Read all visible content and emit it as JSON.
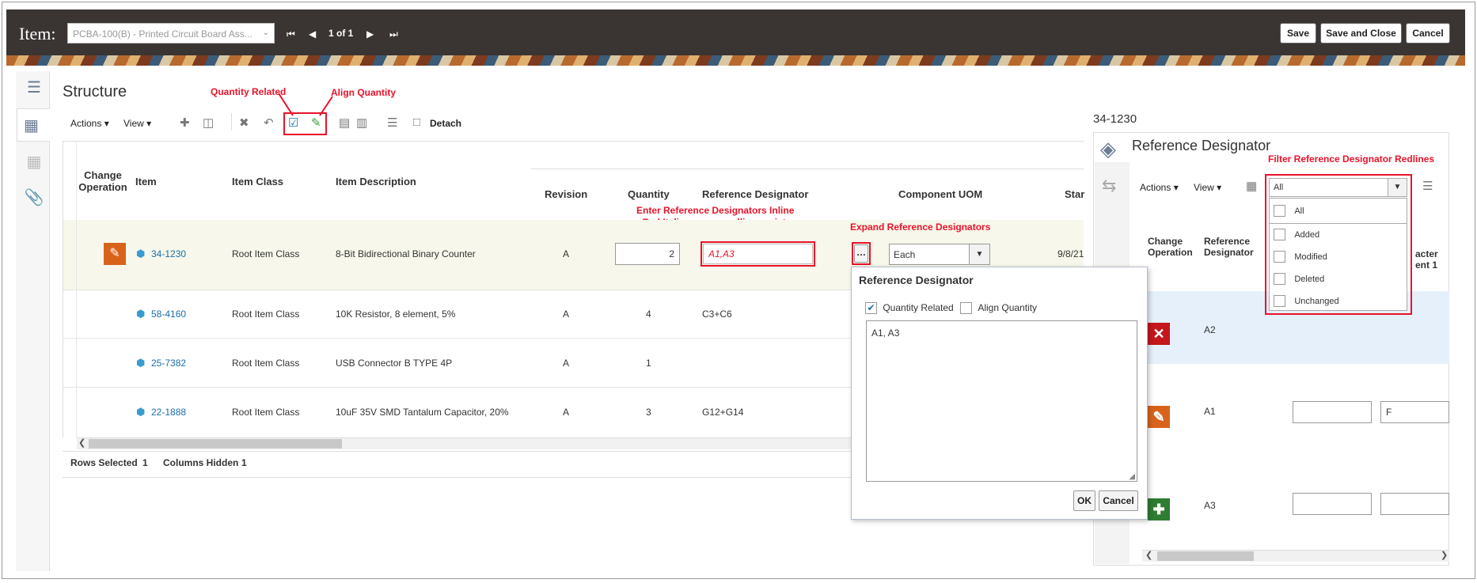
{
  "header": {
    "item_label": "Item:",
    "item_value": "PCBA-100(B) - Printed Circuit Board Ass...",
    "pager_text": "1 of 1",
    "save": "Save",
    "save_close": "Save and Close",
    "cancel": "Cancel"
  },
  "structure": {
    "title": "Structure",
    "actions": "Actions",
    "view": "View",
    "detach": "Detach",
    "columns": {
      "change_operation_1": "Change",
      "change_operation_2": "Operation",
      "item": "Item",
      "item_class": "Item Class",
      "item_description": "Item Description",
      "revision": "Revision",
      "quantity": "Quantity",
      "reference_designator": "Reference Designator",
      "component_uom": "Component UOM",
      "start": "Star"
    },
    "rows": [
      {
        "item": "34-1230",
        "class": "Root Item Class",
        "desc": "8-Bit Bidirectional Binary Counter",
        "rev": "A",
        "qty": "2",
        "refdes": "A1,A3",
        "uom": "Each",
        "start": "9/8/21"
      },
      {
        "item": "58-4160",
        "class": "Root Item Class",
        "desc": "10K Resistor, 8 element, 5%",
        "rev": "A",
        "qty": "4",
        "refdes": "C3+C6"
      },
      {
        "item": "25-7382",
        "class": "Root Item Class",
        "desc": "USB Connector B TYPE 4P",
        "rev": "A",
        "qty": "1",
        "refdes": ""
      },
      {
        "item": "22-1888",
        "class": "Root Item Class",
        "desc": "10uF 35V SMD Tantalum Capacitor, 20%",
        "rev": "A",
        "qty": "3",
        "refdes": "G12+G14"
      }
    ],
    "footer": {
      "rows_selected_label": "Rows Selected",
      "rows_selected_value": "1",
      "columns_hidden_label": "Columns Hidden",
      "columns_hidden_value": "1"
    }
  },
  "annotations": {
    "quantity_related": "Quantity Related",
    "align_quantity": "Align Quantity",
    "enter_inline_1": "Enter Reference Designators Inline",
    "enter_inline_2": "- Red Italics means redlines exist",
    "expand": "Expand Reference Designators",
    "filter": "Filter Reference Designator Redlines"
  },
  "popup": {
    "title": "Reference Designator",
    "quantity_related": "Quantity Related",
    "align_quantity": "Align Quantity",
    "text": "A1, A3",
    "ok": "OK",
    "cancel": "Cancel"
  },
  "right_panel": {
    "item_number": "34-1230",
    "title": "Reference Designator",
    "actions": "Actions",
    "view": "View",
    "filter_value": "All",
    "filter_options": [
      "All",
      "Added",
      "Modified",
      "Deleted",
      "Unchanged"
    ],
    "col_change_1": "Change",
    "col_change_2": "Operation",
    "col_ref_1": "Reference",
    "col_ref_2": "Designator",
    "col_partial_1": "acter",
    "col_partial_2": "ent 1",
    "rows": [
      {
        "designator": "A2",
        "op": "delete"
      },
      {
        "designator": "A1",
        "op": "edit",
        "field2": "F"
      },
      {
        "designator": "A3",
        "op": "add"
      }
    ]
  },
  "colors": {
    "accent_red": "#e8132a",
    "link": "#1a6fa8",
    "edit_orange": "#d8641c",
    "delete_red": "#c4161c",
    "add_green": "#2e7d32"
  }
}
